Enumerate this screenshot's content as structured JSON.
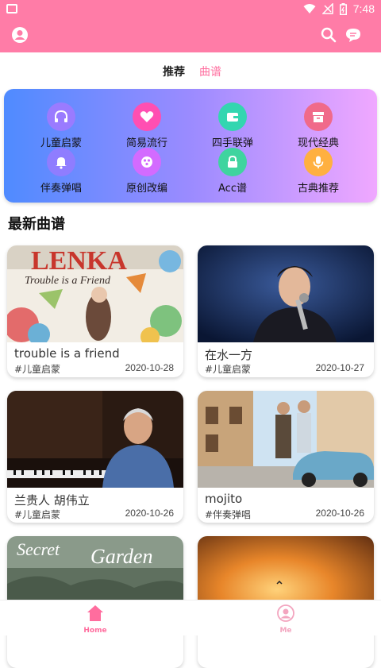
{
  "status_bar": {
    "time": "7:48",
    "icons": [
      "image-icon",
      "wifi-icon",
      "signal-icon",
      "battery-icon"
    ]
  },
  "app_bar": {
    "icons": [
      "user-icon",
      "search-icon",
      "message-icon"
    ],
    "color": "#ff7ca7"
  },
  "tabs": [
    {
      "label": "推荐",
      "active": false
    },
    {
      "label": "曲谱",
      "active": true
    }
  ],
  "categories": [
    {
      "label": "儿童启蒙",
      "icon": "headphones-icon",
      "color": "#9a7bff"
    },
    {
      "label": "简易流行",
      "icon": "heart-icon",
      "color": "#ff4fb2"
    },
    {
      "label": "四手联弹",
      "icon": "wallet-icon",
      "color": "#33d6b0"
    },
    {
      "label": "现代经典",
      "icon": "box-icon",
      "color": "#f06a8a"
    },
    {
      "label": "伴奏弹唱",
      "icon": "bell-icon",
      "color": "#8f7dff"
    },
    {
      "label": "原创改编",
      "icon": "share-icon",
      "color": "#d36bff"
    },
    {
      "label": "Acc谱",
      "icon": "lock-icon",
      "color": "#3fd49f"
    },
    {
      "label": "古典推荐",
      "icon": "microphone-icon",
      "color": "#ffb040"
    }
  ],
  "section_title": "最新曲谱",
  "cards": [
    {
      "title": "trouble is a friend",
      "tag": "#儿童启蒙",
      "date": "2020-10-28",
      "image": "lenka-album-cover"
    },
    {
      "title": "在水一方",
      "tag": "#儿童启蒙",
      "date": "2020-10-27",
      "image": "singer-on-stage"
    },
    {
      "title": "兰贵人 胡伟立",
      "tag": "#儿童启蒙",
      "date": "2020-10-26",
      "image": "pianist-photo"
    },
    {
      "title": "mojito",
      "tag": "#伴奏弹唱",
      "date": "2020-10-26",
      "image": "street-with-car"
    },
    {
      "title": "",
      "tag": "",
      "date": "",
      "image": "secret-garden-cover"
    },
    {
      "title": "",
      "tag": "",
      "date": "",
      "image": "sunset-sky"
    }
  ],
  "cover_text": {
    "lenka": "LENKA",
    "lenka_sub": "Trouble is a Friend",
    "secret": "Secret",
    "garden": "Garden"
  },
  "bottom_nav": [
    {
      "label": "Home",
      "icon": "home-icon",
      "active": true
    },
    {
      "label": "Me",
      "icon": "person-icon",
      "active": false
    }
  ],
  "colors": {
    "accent": "#ff6d9e",
    "nav_inactive": "#f3a5bf"
  }
}
